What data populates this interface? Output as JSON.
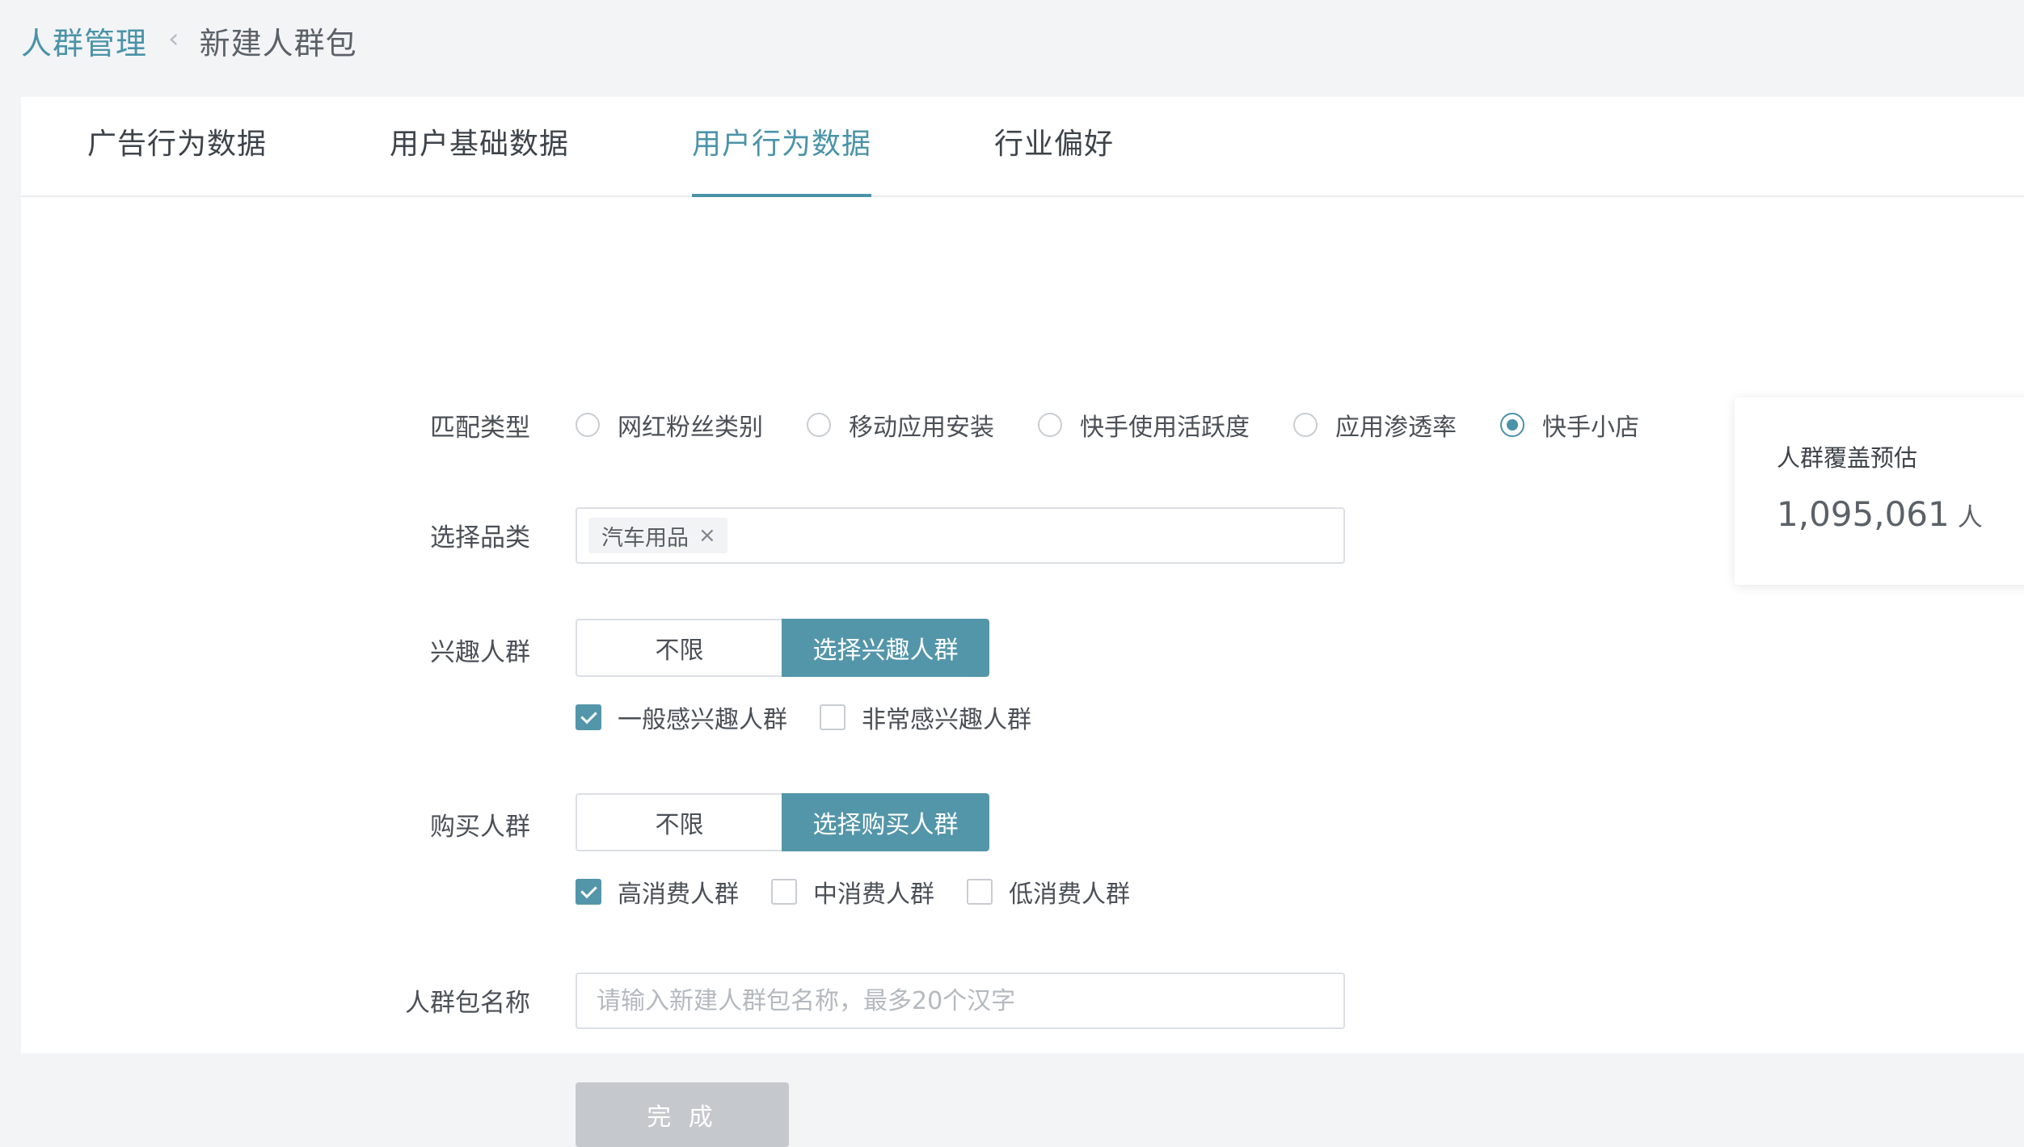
{
  "breadcrumb": {
    "root": "人群管理",
    "separator": "‹",
    "current": "新建人群包"
  },
  "tabs": [
    {
      "label": "广告行为数据",
      "active": false
    },
    {
      "label": "用户基础数据",
      "active": false
    },
    {
      "label": "用户行为数据",
      "active": true
    },
    {
      "label": "行业偏好",
      "active": false
    }
  ],
  "form": {
    "match_type": {
      "label": "匹配类型",
      "options": [
        "网红粉丝类别",
        "移动应用安装",
        "快手使用活跃度",
        "应用渗透率",
        "快手小店"
      ],
      "selected": "快手小店"
    },
    "category": {
      "label": "选择品类",
      "tags": [
        "汽车用品"
      ],
      "remove_icon": "×"
    },
    "interest": {
      "label": "兴趣人群",
      "options": [
        "不限",
        "选择兴趣人群"
      ],
      "selected": "选择兴趣人群",
      "checkboxes": [
        {
          "label": "一般感兴趣人群",
          "checked": true
        },
        {
          "label": "非常感兴趣人群",
          "checked": false
        }
      ]
    },
    "purchase": {
      "label": "购买人群",
      "options": [
        "不限",
        "选择购买人群"
      ],
      "selected": "选择购买人群",
      "checkboxes": [
        {
          "label": "高消费人群",
          "checked": true
        },
        {
          "label": "中消费人群",
          "checked": false
        },
        {
          "label": "低消费人群",
          "checked": false
        }
      ]
    },
    "name": {
      "label": "人群包名称",
      "value": "",
      "placeholder": "请输入新建人群包名称，最多20个汉字"
    },
    "submit_label": "完 成"
  },
  "estimate": {
    "title": "人群覆盖预估",
    "value": "1,095,061",
    "unit": "人"
  },
  "colors": {
    "accent": "#4a93a8",
    "button_active": "#5496a9",
    "button_disabled": "#c5c8cc"
  }
}
